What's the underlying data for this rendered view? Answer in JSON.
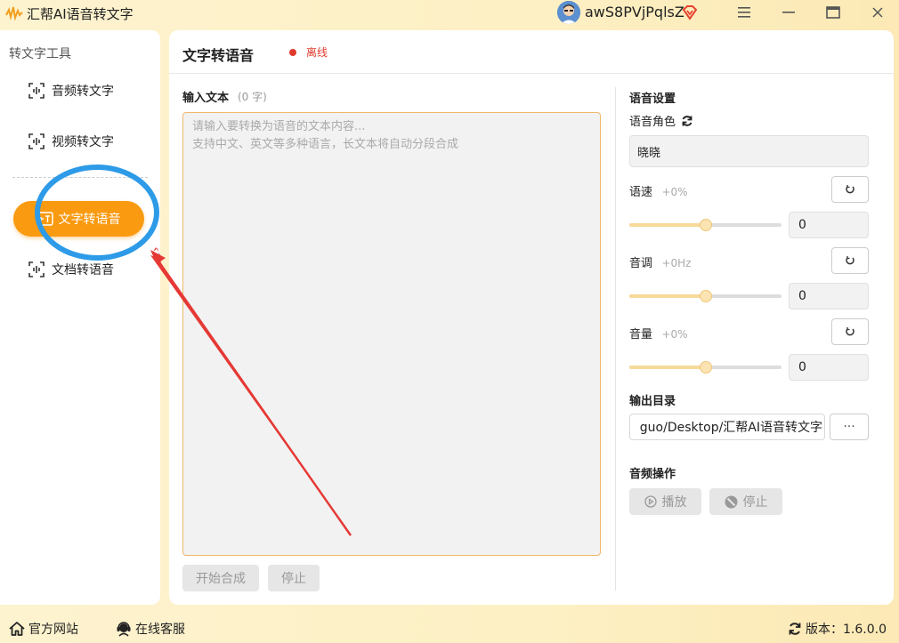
{
  "app": {
    "title": "汇帮AI语音转文字",
    "username": "awS8PVjPqlsZ"
  },
  "window_controls": {
    "menu_icon": "menu-icon",
    "minimize_icon": "minimize-icon",
    "maximize_icon": "maximize-icon",
    "close_icon": "close-icon"
  },
  "sidebar": {
    "heading": "转文字工具",
    "items": [
      {
        "label": "音频转文字",
        "icon": "audio-wave-icon"
      },
      {
        "label": "视频转文字",
        "icon": "video-wave-icon"
      },
      {
        "label": "文字转语音",
        "icon": "text-to-speech-icon",
        "active": true
      },
      {
        "label": "文档转语音",
        "icon": "document-wave-icon"
      }
    ]
  },
  "main": {
    "title": "文字转语音",
    "status": "离线",
    "input_label": "输入文本",
    "char_count": "(0 字)",
    "placeholder_line1": "请输入要转换为语音的文本内容...",
    "placeholder_line2": "支持中文、英文等多种语言，长文本将自动分段合成",
    "start_button": "开始合成",
    "stop_button": "停止"
  },
  "settings": {
    "heading": "语音设置",
    "voice_role_label": "语音角色",
    "voice_role_value": "晓晓",
    "rate": {
      "label": "语速",
      "hint": "+0%",
      "value": "0",
      "level": 0.5
    },
    "pitch": {
      "label": "音调",
      "hint": "+0Hz",
      "value": "0",
      "level": 0.5
    },
    "volume": {
      "label": "音量",
      "hint": "+0%",
      "value": "0",
      "level": 0.5
    },
    "output_heading": "输出目录",
    "output_path": "guo/Desktop/汇帮AI语音转文字",
    "browse_button": "···",
    "audio_heading": "音频操作",
    "play_button": "播放",
    "audio_stop_button": "停止"
  },
  "footer": {
    "website": "官方网站",
    "support": "在线客服",
    "version": "版本：1.6.0.0"
  },
  "colors": {
    "accent": "#f99a10",
    "status_offline": "#e03a2e",
    "annotation_circle": "#2d9be8",
    "annotation_arrow": "#e53935"
  }
}
